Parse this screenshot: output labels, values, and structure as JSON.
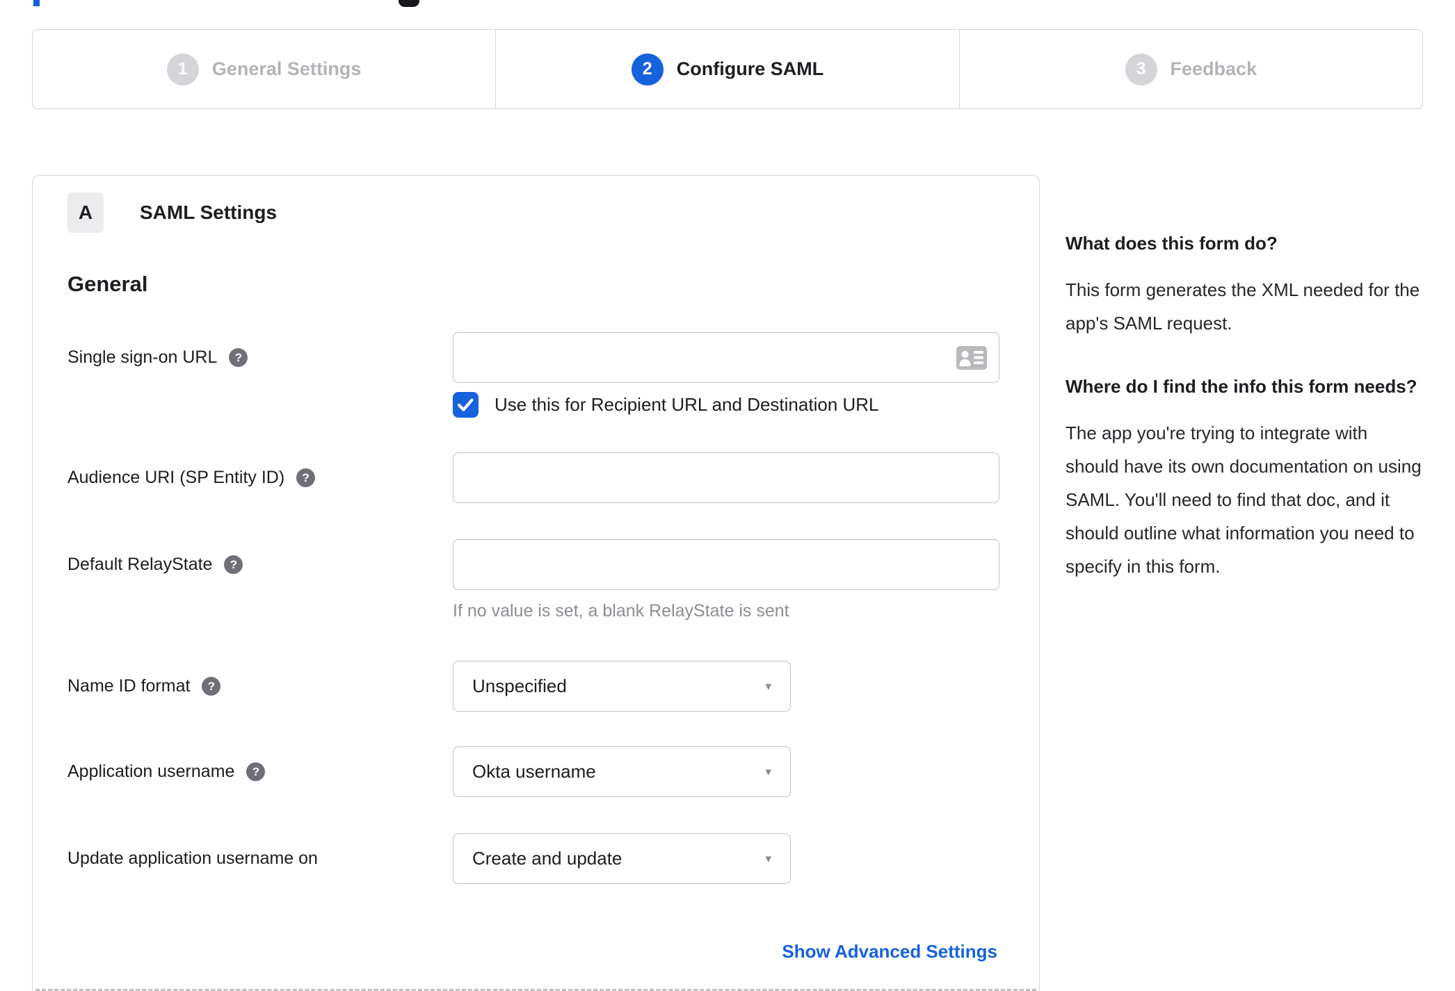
{
  "icons": {
    "help": "?",
    "caret": "▾"
  },
  "colors": {
    "accent_blue": "#1662dd",
    "inactive_gray": "#b3b3b8",
    "border_gray": "#d7d7da",
    "input_border": "#c2c2c6",
    "hint_gray": "#8d8d93"
  },
  "stepper": {
    "steps": [
      {
        "number": "1",
        "label": "General Settings",
        "state": "inactive"
      },
      {
        "number": "2",
        "label": "Configure SAML",
        "state": "active"
      },
      {
        "number": "3",
        "label": "Feedback",
        "state": "inactive"
      }
    ]
  },
  "panel": {
    "section_letter": "A",
    "section_title": "SAML Settings",
    "group_title": "General",
    "advanced_settings_link": "Show Advanced Settings"
  },
  "form": {
    "sso_url": {
      "label": "Single sign-on URL",
      "value": "",
      "checkbox_label": "Use this for Recipient URL and Destination URL",
      "checkbox_checked": true
    },
    "audience_uri": {
      "label": "Audience URI (SP Entity ID)",
      "value": ""
    },
    "default_relay_state": {
      "label": "Default RelayState",
      "value": "",
      "hint": "If no value is set, a blank RelayState is sent"
    },
    "name_id_format": {
      "label": "Name ID format",
      "selected": "Unspecified"
    },
    "application_username": {
      "label": "Application username",
      "selected": "Okta username"
    },
    "update_application_username_on": {
      "label": "Update application username on",
      "selected": "Create and update"
    }
  },
  "sidebar": {
    "heading_1": "What does this form do?",
    "paragraph_1": "This form generates the XML needed for the app's SAML request.",
    "heading_2": "Where do I find the info this form needs?",
    "paragraph_2": "The app you're trying to integrate with should have its own documentation on using SAML. You'll need to find that doc, and it should outline what information you need to specify in this form."
  }
}
